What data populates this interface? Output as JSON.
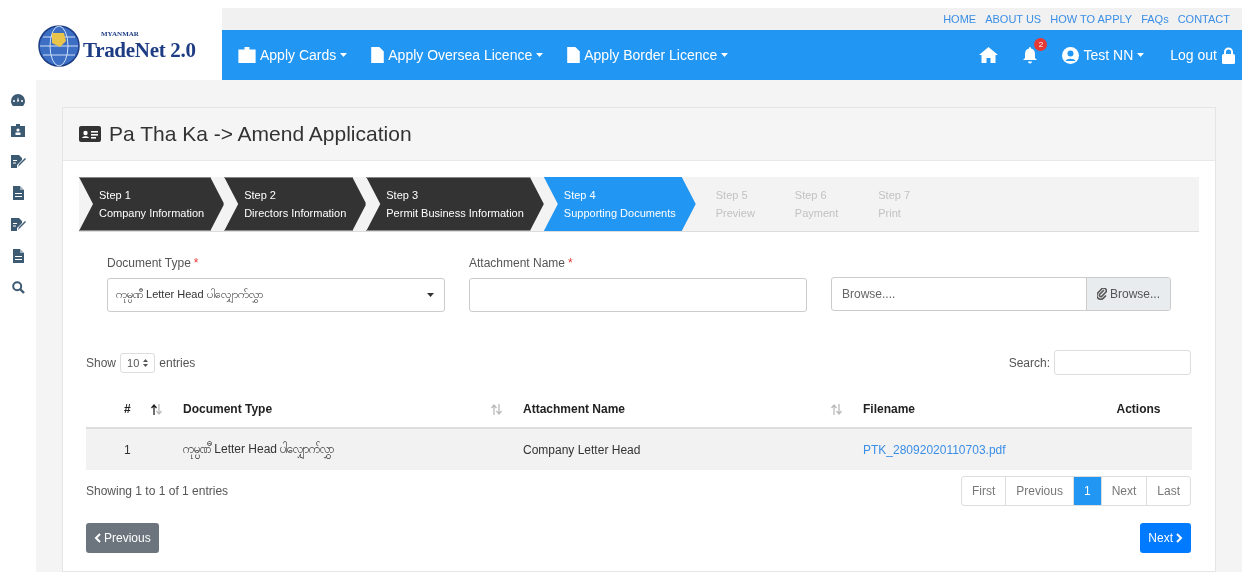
{
  "header": {
    "logo": {
      "small": "MYANMAR",
      "title": "TradeNet 2.0"
    },
    "top_links": [
      "HOME",
      "ABOUT US",
      "HOW TO APPLY",
      "FAQs",
      "CONTACT"
    ],
    "menu": [
      {
        "label": "Apply Cards",
        "kind": "card"
      },
      {
        "label": "Apply Oversea Licence",
        "kind": "document"
      },
      {
        "label": "Apply Border Licence",
        "kind": "document"
      }
    ],
    "notifications": "2",
    "user": "Test NN",
    "logout": "Log out"
  },
  "sidebar": {
    "items": [
      {
        "kind": "dashboard"
      },
      {
        "kind": "card"
      },
      {
        "kind": "edit"
      },
      {
        "kind": "document"
      },
      {
        "kind": "edit"
      },
      {
        "kind": "document"
      },
      {
        "kind": "search"
      }
    ]
  },
  "page": {
    "title": "Pa Tha Ka -> Amend Application"
  },
  "steps": [
    {
      "title": "Step 1",
      "label": "Company Information",
      "completed": true,
      "selected": false
    },
    {
      "title": "Step 2",
      "label": "Directors Information",
      "completed": true,
      "selected": false
    },
    {
      "title": "Step 3",
      "label": "Permit Business Information",
      "completed": true,
      "selected": false
    },
    {
      "title": "Step 4",
      "label": "Supporting Documents",
      "completed": false,
      "selected": true
    },
    {
      "title": "Step 5",
      "label": "Preview",
      "completed": false,
      "selected": false
    },
    {
      "title": "Step 6",
      "label": "Payment",
      "completed": false,
      "selected": false
    },
    {
      "title": "Step 7",
      "label": "Print",
      "completed": false,
      "selected": false
    }
  ],
  "form": {
    "document_type": {
      "label": "Document Type",
      "mark": "*",
      "value": "ကုမ္ပဏီ Letter Head ပါလျှောက်လွှာ"
    },
    "attachment_name": {
      "label": "Attachment Name",
      "mark": "*"
    },
    "file": {
      "placeholder": "Browse....",
      "button": "Browse..."
    }
  },
  "table": {
    "show_label": "Show",
    "length": "10",
    "entries_label": "entries",
    "search_label": "Search:",
    "columns": [
      {
        "label": "#",
        "sortable": true,
        "sorted": true
      },
      {
        "label": "Document Type",
        "sortable": true,
        "sorted": false
      },
      {
        "label": "Attachment Name",
        "sortable": true,
        "sorted": false
      },
      {
        "label": "Filename"
      },
      {
        "label": "Actions"
      }
    ],
    "rows": [
      {
        "number": "1",
        "document_type": "ကုမ္ပဏီ Letter Head ပါလျှောက်လွှာ",
        "attachment_name": "Company Letter Head",
        "filename": "PTK_28092020110703.pdf"
      }
    ],
    "info": "Showing 1 to 1 of 1 entries",
    "pagination": [
      {
        "label": "First",
        "selected": false
      },
      {
        "label": "Previous",
        "selected": false
      },
      {
        "label": "1",
        "selected": true
      },
      {
        "label": "Next",
        "selected": false
      },
      {
        "label": "Last",
        "selected": false
      }
    ]
  },
  "buttons": {
    "previous": "Previous",
    "next": "Next"
  }
}
